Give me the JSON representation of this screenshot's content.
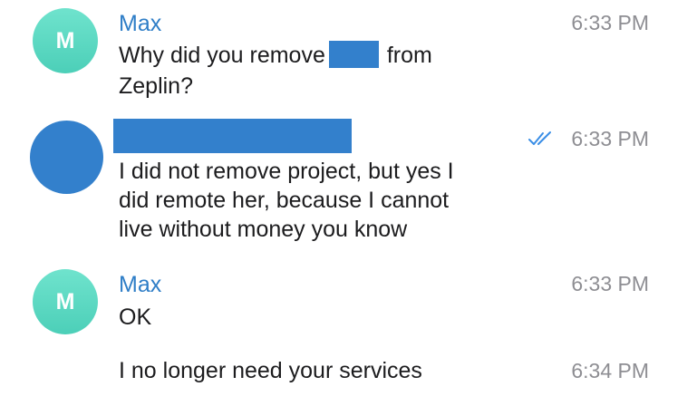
{
  "messages": [
    {
      "avatar_letter": "M",
      "sender": "Max",
      "time": "6:33 PM",
      "line1_before": "Why did you remove",
      "line1_after": "from",
      "line2": "Zeplin?"
    },
    {
      "time": "6:33 PM",
      "read_status": "double-check-icon",
      "lines": [
        "I did not remove project, but yes I",
        "did remote her, because I cannot",
        "live without money you know"
      ]
    },
    {
      "avatar_letter": "M",
      "sender": "Max",
      "time": "6:33 PM",
      "text": "OK"
    },
    {
      "time": "6:34 PM",
      "text": "I no longer need your services"
    }
  ],
  "colors": {
    "sender_name": "#2f7ec7",
    "avatar_max": "#5ad8c2",
    "redaction": "#3380cc",
    "timestamp": "#8e8e93",
    "check": "#3a8ee6"
  }
}
